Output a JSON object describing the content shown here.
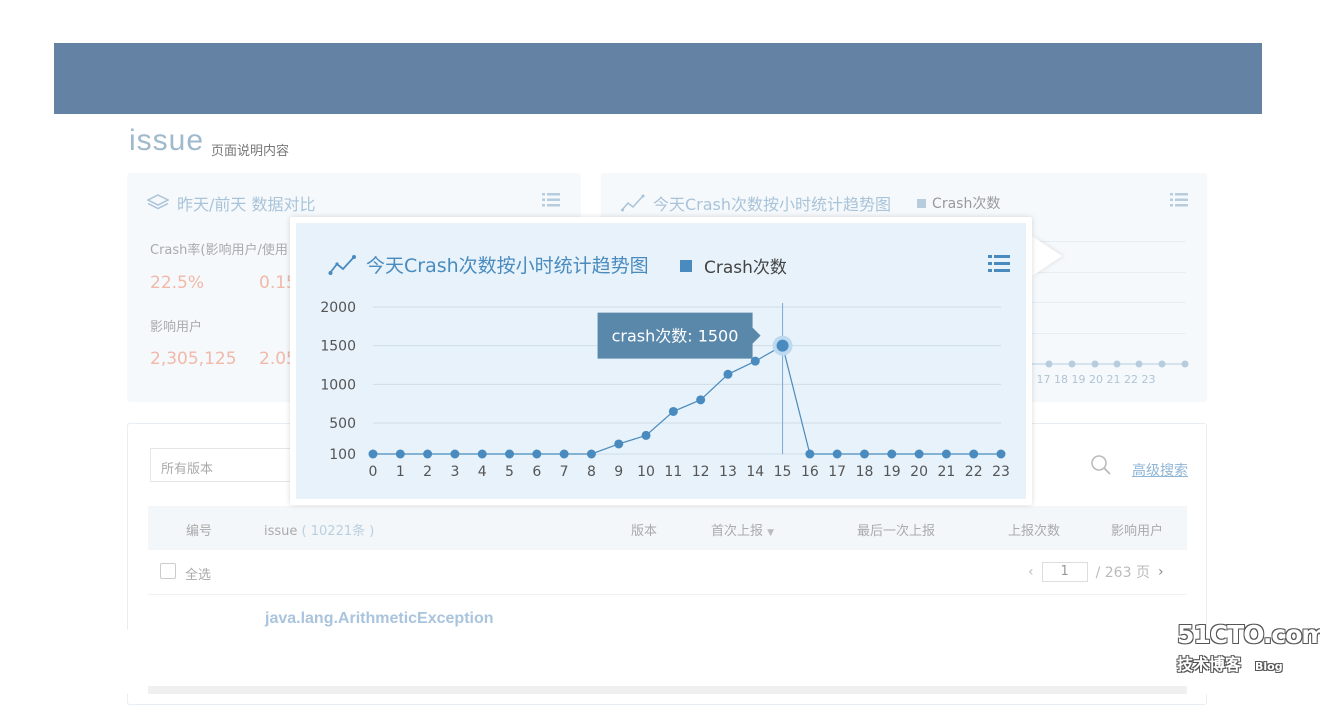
{
  "page": {
    "title": "issue",
    "description": "页面说明内容"
  },
  "left_panel": {
    "title": "昨天/前天 数据对比",
    "crash_rate_label": "Crash率(影响用户/使用",
    "crash_rate_value1": "22.5%",
    "crash_rate_value2": "0.15",
    "affected_label": "影响用户",
    "affected_value1": "2,305,125",
    "affected_value2": "2.05"
  },
  "right_panel": {
    "title": "今天Crash次数按小时统计趋势图",
    "legend": "Crash次数",
    "axis_ticks": "5  17  18  19  20  21  22  23"
  },
  "popup": {
    "title": "今天Crash次数按小时统计趋势图",
    "legend": "Crash次数",
    "tooltip": "crash次数: 1500"
  },
  "filters": {
    "version_select": "所有版本",
    "advanced_search": "高级搜索"
  },
  "table": {
    "headers": {
      "id": "编号",
      "issue": "issue",
      "issue_count": "( 10221条 )",
      "version": "版本",
      "first_report": "首次上报",
      "last_report": "最后一次上报",
      "report_count": "上报次数",
      "affected_users": "影响用户"
    },
    "select_all": "全选",
    "pager": {
      "current": "1",
      "total": "/ 263 页"
    },
    "first_row_issue": "java.lang.ArithmeticException"
  },
  "watermark": {
    "line1": "51CTO.com",
    "line2": "技术博客",
    "line2_small": "Blog"
  },
  "colors": {
    "topbar": "#6482a4",
    "chart_line": "#4a8bbf",
    "tooltip_bg": "#5a88ab",
    "value_red": "#f2b8a8"
  },
  "chart_data": {
    "type": "line",
    "title": "今天Crash次数按小时统计趋势图",
    "x": [
      0,
      1,
      2,
      3,
      4,
      5,
      6,
      7,
      8,
      9,
      10,
      11,
      12,
      13,
      14,
      15,
      16,
      17,
      18,
      19,
      20,
      21,
      22,
      23
    ],
    "series": [
      {
        "name": "Crash次数",
        "values": [
          100,
          100,
          100,
          100,
          100,
          100,
          100,
          100,
          100,
          230,
          340,
          650,
          800,
          1130,
          1300,
          1500,
          100,
          100,
          100,
          100,
          100,
          100,
          100,
          100
        ]
      }
    ],
    "y_ticks": [
      100,
      500,
      1000,
      1500,
      2000
    ],
    "ylim": [
      0,
      2000
    ],
    "highlight_index": 15,
    "grid": true
  }
}
